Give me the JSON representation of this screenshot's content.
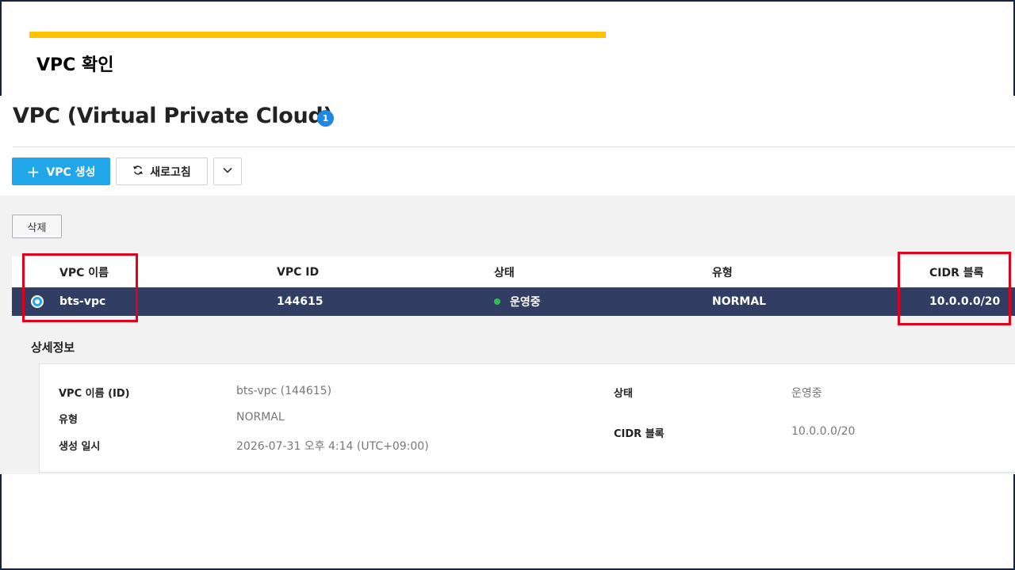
{
  "slide": {
    "title": "VPC 확인",
    "accent_color": "#fdc300"
  },
  "page": {
    "title": "VPC (Virtual Private Cloud)",
    "count_badge": "1"
  },
  "toolbar": {
    "create_label": "VPC 생성",
    "create_icon": "plus-icon",
    "refresh_label": "새로고침",
    "refresh_icon": "refresh-icon",
    "more_icon": "chevron-down-icon",
    "delete_label": "삭제"
  },
  "table": {
    "columns": [
      "VPC 이름",
      "VPC ID",
      "상태",
      "유형",
      "CIDR 블록"
    ],
    "rows": [
      {
        "selected": true,
        "name": "bts-vpc",
        "id": "144615",
        "status": "운영중",
        "status_color": "#2fbd4a",
        "type": "NORMAL",
        "cidr": "10.0.0.0/20"
      }
    ],
    "selected_row_color": "#323d64"
  },
  "details": {
    "section_title": "상세정보",
    "fields": {
      "name_id_label": "VPC 이름 (ID)",
      "name_id_value": "bts-vpc (144615)",
      "type_label": "유형",
      "type_value": "NORMAL",
      "created_label": "생성 일시",
      "created_value": "2026-07-31 오후 4:14 (UTC+09:00)",
      "status_label": "상태",
      "status_value": "운영중",
      "cidr_label": "CIDR 블록",
      "cidr_value": "10.0.0.0/20"
    }
  },
  "colors": {
    "primary_button": "#21a6ea",
    "badge": "#1e88e5",
    "highlight_box": "#e3001b"
  }
}
